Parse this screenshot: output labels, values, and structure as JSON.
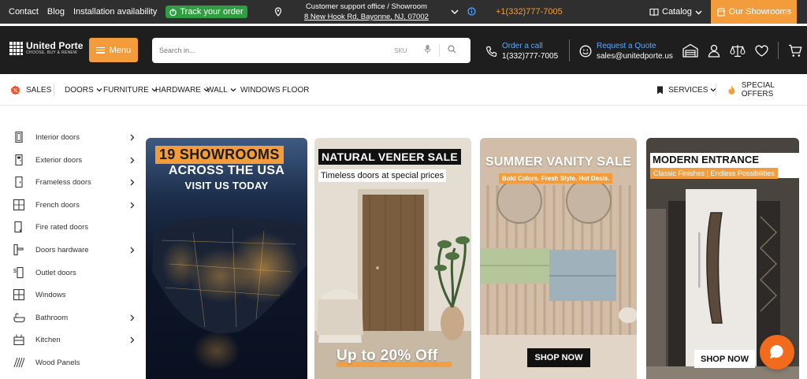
{
  "topbar": {
    "links": [
      "Contact",
      "Blog",
      "Installation availability"
    ],
    "track_order": "Track your order",
    "office_title": "Customer support office / Showroom",
    "office_address": "8 New Hook Rd, Bayonne, NJ, 07002",
    "phone": "+1(332)777-7005",
    "catalog": "Catalog",
    "showrooms": "Our Showrooms"
  },
  "header": {
    "logo_brand": "United Porte",
    "logo_tagline": "CHOOSE, BUY & RENEW",
    "menu_label": "Menu",
    "search_placeholder": "Search in...",
    "search_sku": "SKU",
    "call_label": "Order a call",
    "call_number": "1(332)777-7005",
    "quote_label": "Request a Quote",
    "quote_email": "sales@unitedporte.us"
  },
  "nav": {
    "sales": "SALES",
    "items": [
      "DOORS",
      "FURNITURE",
      "HARDWARE",
      "WALL",
      "WINDOWS",
      "FLOOR"
    ],
    "services": "SERVICES",
    "special": "SPECIAL OFFERS"
  },
  "sidebar": {
    "items": [
      {
        "label": "Interior doors",
        "icon": "interior-door-icon",
        "chevron": true
      },
      {
        "label": "Exterior doors",
        "icon": "exterior-door-icon",
        "chevron": true
      },
      {
        "label": "Frameless doors",
        "icon": "frameless-door-icon",
        "chevron": true
      },
      {
        "label": "French doors",
        "icon": "french-door-icon",
        "chevron": true
      },
      {
        "label": "Fire rated doors",
        "icon": "fire-door-icon",
        "chevron": false
      },
      {
        "label": "Doors hardware",
        "icon": "door-handle-icon",
        "chevron": true
      },
      {
        "label": "Outlet doors",
        "icon": "outlet-door-icon",
        "chevron": false
      },
      {
        "label": "Windows",
        "icon": "window-icon",
        "chevron": false
      },
      {
        "label": "Bathroom",
        "icon": "bathtub-icon",
        "chevron": true
      },
      {
        "label": "Kitchen",
        "icon": "kitchen-icon",
        "chevron": true
      },
      {
        "label": "Wood Panels",
        "icon": "wood-panel-icon",
        "chevron": false
      }
    ]
  },
  "banners": {
    "b1": {
      "line1": "19 SHOWROOMS",
      "line2": "ACROSS THE USA",
      "line3": "VISIT US TODAY"
    },
    "b2": {
      "title": "NATURAL VENEER SALE",
      "subtitle": "Timeless doors at special prices",
      "footer": "Up to 20% Off"
    },
    "b3": {
      "title": "SUMMER VANITY SALE",
      "subtitle": "Bold Colors. Fresh Style. Hot Deals.",
      "cta": "SHOP NOW"
    },
    "b4": {
      "title": "MODERN ENTRANCE DOORS",
      "subtitle": "Classic Finishes | Endless Possibilities",
      "cta": "SHOP NOW"
    }
  },
  "colors": {
    "accent": "#f39c3c",
    "topbar": "#2f2f2f",
    "header": "#1e1e1e",
    "track": "#2f9e41",
    "link_blue": "#5aa8ff"
  }
}
